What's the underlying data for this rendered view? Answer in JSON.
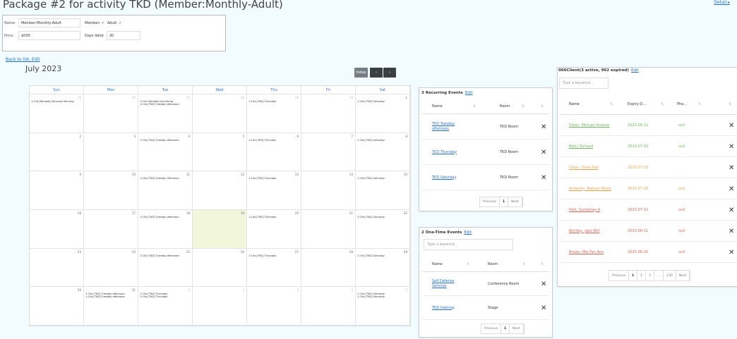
{
  "page": {
    "title": "Package #2 for activity TKD (Member:Monthly-Adult)",
    "top_right_link": "Detail ▸"
  },
  "info": {
    "name_label": "Name:",
    "name_value": "Member:Monthly-Adult",
    "member_label": "Member: ✓",
    "adult_label": "Adult: ✓",
    "price_label": "Price:",
    "price_value": "$000",
    "days_valid_label": "Days Valid:",
    "days_valid_value": "30"
  },
  "back_link": "Back to list, Edit",
  "calendar": {
    "title": "July 2023",
    "today_button": "today",
    "prev_icon": "‹",
    "next_icon": "›",
    "weekdays": [
      "Sun",
      "Mon",
      "Tue",
      "Wed",
      "Thu",
      "Fri",
      "Sat"
    ],
    "weeks": [
      [
        {
          "n": "25",
          "o": true,
          "ev": [
            "1:15a [Ranked] Saturday Morning"
          ]
        },
        {
          "n": "26",
          "o": true,
          "ev": []
        },
        {
          "n": "27",
          "o": true,
          "ev": [
            "1:15a [Ranked] Lynchburg",
            "1:15a [TKD] Tuesday afternoon"
          ]
        },
        {
          "n": "28",
          "o": true,
          "ev": []
        },
        {
          "n": "29",
          "o": true,
          "ev": [
            "1:15a [TKD] Thursday"
          ]
        },
        {
          "n": "30",
          "o": true,
          "ev": []
        },
        {
          "n": "1",
          "o": false,
          "ev": [
            "1:15a [TKD] Saturday"
          ]
        }
      ],
      [
        {
          "n": "2",
          "o": false,
          "ev": []
        },
        {
          "n": "3",
          "o": false,
          "ev": []
        },
        {
          "n": "4",
          "o": false,
          "ev": [
            "1:15a [TKD] Tuesday afternoon"
          ]
        },
        {
          "n": "5",
          "o": false,
          "ev": []
        },
        {
          "n": "6",
          "o": false,
          "ev": [
            "1:15a [TKD] Thursday"
          ]
        },
        {
          "n": "7",
          "o": false,
          "ev": []
        },
        {
          "n": "8",
          "o": false,
          "ev": [
            "1:15a [TKD] Saturday"
          ]
        }
      ],
      [
        {
          "n": "9",
          "o": false,
          "ev": []
        },
        {
          "n": "10",
          "o": false,
          "ev": []
        },
        {
          "n": "11",
          "o": false,
          "ev": [
            "1:15a [TKD] Tuesday afternoon"
          ]
        },
        {
          "n": "12",
          "o": false,
          "ev": []
        },
        {
          "n": "13",
          "o": false,
          "ev": [
            "1:15a [TKD] Thursday"
          ]
        },
        {
          "n": "14",
          "o": false,
          "ev": []
        },
        {
          "n": "15",
          "o": false,
          "ev": [
            "1:15a [TKD] Saturday"
          ]
        }
      ],
      [
        {
          "n": "16",
          "o": false,
          "ev": []
        },
        {
          "n": "17",
          "o": false,
          "ev": []
        },
        {
          "n": "18",
          "o": false,
          "ev": [
            "1:15a [TKD] Tuesday afternoon"
          ]
        },
        {
          "n": "19",
          "o": false,
          "ev": [],
          "today": true
        },
        {
          "n": "20",
          "o": false,
          "ev": [
            "1:15a [TKD] Thursday"
          ]
        },
        {
          "n": "21",
          "o": false,
          "ev": []
        },
        {
          "n": "22",
          "o": false,
          "ev": [
            "1:15a [TKD] Saturday"
          ]
        }
      ],
      [
        {
          "n": "23",
          "o": false,
          "ev": []
        },
        {
          "n": "24",
          "o": false,
          "ev": []
        },
        {
          "n": "25",
          "o": false,
          "ev": [
            "1:15a [TKD] Tuesday afternoon"
          ]
        },
        {
          "n": "26",
          "o": false,
          "ev": []
        },
        {
          "n": "27",
          "o": false,
          "ev": [
            "1:15a [TKD] Thursday"
          ]
        },
        {
          "n": "28",
          "o": false,
          "ev": []
        },
        {
          "n": "29",
          "o": false,
          "ev": [
            "1:15a [TKD] Saturday"
          ]
        }
      ],
      [
        {
          "n": "30",
          "o": false,
          "ev": []
        },
        {
          "n": "31",
          "o": false,
          "ev": [
            "1:15a [TKD] Tuesday afternoon",
            "1:15a [TKD] Tuesday afternoon"
          ]
        },
        {
          "n": "1",
          "o": true,
          "ev": [
            "1:15a [TKD] Thursday",
            "1:15a [TKD] Thursday"
          ]
        },
        {
          "n": "2",
          "o": true,
          "ev": []
        },
        {
          "n": "3",
          "o": true,
          "ev": []
        },
        {
          "n": "4",
          "o": true,
          "ev": []
        },
        {
          "n": "5",
          "o": true,
          "ev": [
            "1:15a [TKD] Saturday",
            "1:15a [TKD] Saturday"
          ]
        }
      ]
    ]
  },
  "recurring": {
    "title": "3 Recurring Events",
    "edit": "Edit",
    "col_name": "Name",
    "col_room": "Room",
    "rows": [
      {
        "name": "TKD Tuesday afternoon",
        "room": "TKD Room"
      },
      {
        "name": "TKD Thursday",
        "room": "TKD Room"
      },
      {
        "name": "TKD Saturday",
        "room": "TKD Room"
      }
    ],
    "pager": {
      "prev": "Previous",
      "page": "1",
      "next": "Next"
    }
  },
  "onetime": {
    "title": "2 One-Time Events",
    "edit": "Edit",
    "search_placeholder": "Type a keyword...",
    "col_name": "Name",
    "col_room": "Room",
    "rows": [
      {
        "name": "Self Defense Seminar",
        "room": "Conference Room"
      },
      {
        "name": "TKD training",
        "room": "Stage"
      }
    ],
    "pager": {
      "prev": "Previous",
      "page": "1",
      "next": "Next"
    }
  },
  "members": {
    "title": "066Client(3 active, 962 expired)",
    "edit": "Edit",
    "search_placeholder": "Type a keyword...",
    "col_name": "Name",
    "col_expiry": "Expiry D...",
    "col_phone": "Pho...",
    "rows": [
      {
        "name": "Dolan, Michael Andrew",
        "expiry": "2023-08-12",
        "phone": "null",
        "status": "green"
      },
      {
        "name": "Mehl, Richard",
        "expiry": "2023-07-30",
        "phone": "null",
        "status": "green"
      },
      {
        "name": "Dolan, Dave Neil",
        "expiry": "2023-07-18",
        "phone": "",
        "status": "orange"
      },
      {
        "name": "Anderley, Nathan Nikita",
        "expiry": "2023-07-20",
        "phone": "null",
        "status": "orange"
      },
      {
        "name": "Hett, Sunderlay A",
        "expiry": "2023-07-11",
        "phone": "null",
        "status": "red"
      },
      {
        "name": "Bentley, Jake Will",
        "expiry": "2023-06-11",
        "phone": "null",
        "status": "red"
      },
      {
        "name": "Brown, Mia Fan Ann",
        "expiry": "2023-06-26",
        "phone": "null",
        "status": "red"
      }
    ],
    "pager": {
      "prev": "Previous",
      "pages": [
        "1",
        "2",
        "3",
        "...",
        "130"
      ],
      "next": "Next"
    }
  }
}
